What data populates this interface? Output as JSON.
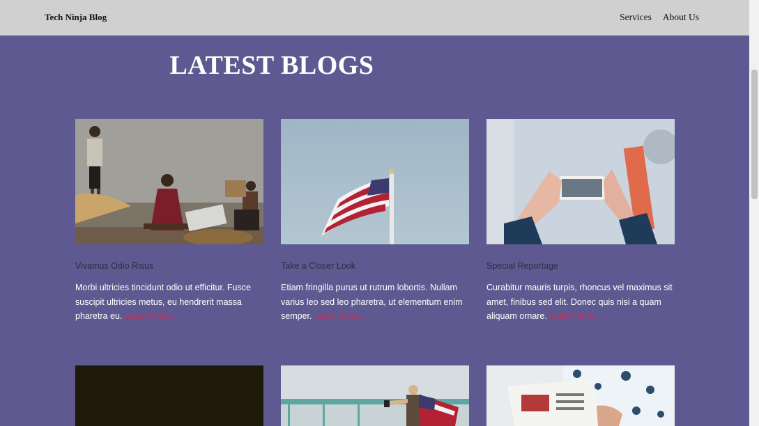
{
  "nav": {
    "brand": "Tech Ninja Blog",
    "links": [
      "Services",
      "About Us"
    ]
  },
  "page": {
    "heading": "LATEST BLOGS"
  },
  "posts": [
    {
      "title": "Vivamus Odio Risus",
      "text": "Morbi ultricies tincidunt odio ut efficitur. Fusce suscipit ultricies metus, eu hendrerit massa pharetra eu. ",
      "link": "Learn more..."
    },
    {
      "title": "Take a Closer Look",
      "text": "Etiam fringilla purus ut rutrum lobortis. Nullam varius leo sed leo pharetra, ut elementum enim semper. ",
      "link": "Learn more..."
    },
    {
      "title": "Special Reportage",
      "text": "Curabitur mauris turpis, rhoncus vel maximus sit amet, finibus sed elit. Donec quis nisi a quam aliquam ornare. ",
      "link": "Learn more..."
    }
  ],
  "colors": {
    "background": "#5e5a91",
    "navbar": "#d0d0d0",
    "link": "#b8315d"
  }
}
